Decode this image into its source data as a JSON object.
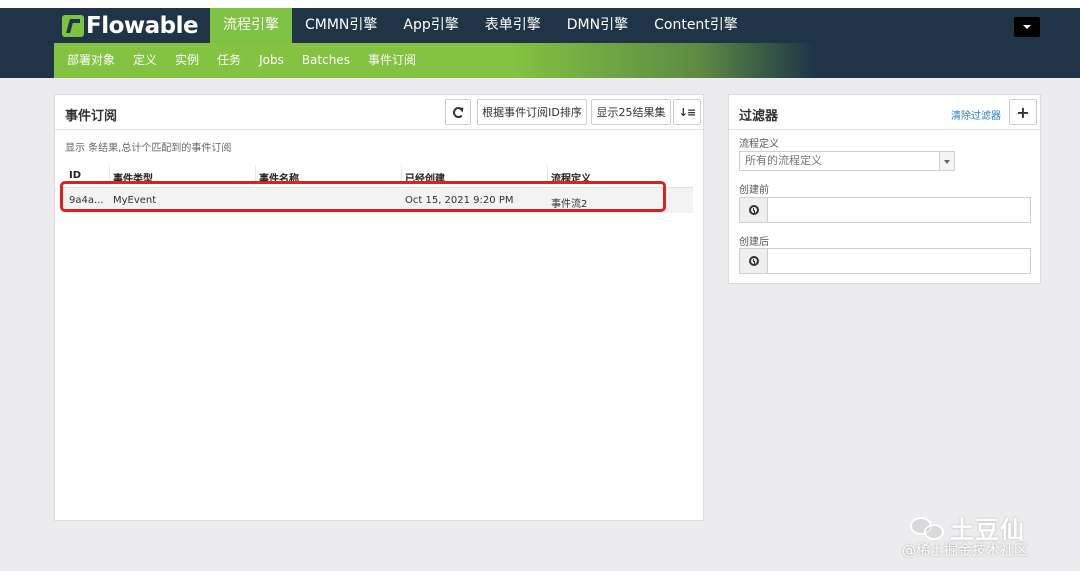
{
  "app": {
    "logo_text": "Flowable"
  },
  "main_nav": [
    {
      "label": "流程引擎",
      "active": true
    },
    {
      "label": "CMMN引擎"
    },
    {
      "label": "App引擎"
    },
    {
      "label": "表单引擎"
    },
    {
      "label": "DMN引擎"
    },
    {
      "label": "Content引擎"
    }
  ],
  "sub_nav": [
    {
      "label": "部署对象"
    },
    {
      "label": "定义"
    },
    {
      "label": "实例"
    },
    {
      "label": "任务"
    },
    {
      "label": "Jobs"
    },
    {
      "label": "Batches"
    },
    {
      "label": "事件订阅",
      "active": true
    }
  ],
  "list_panel": {
    "title": "事件订阅",
    "sort_button": "根据事件订阅ID排序",
    "show_button": "显示25结果集",
    "summary": "显示 条结果,总计个匹配到的事件订阅",
    "columns": [
      "ID",
      "事件类型",
      "事件名称",
      "已经创建",
      "流程定义"
    ],
    "rows": [
      {
        "id": "9a4a...",
        "event_type": "MyEvent",
        "event_name": "",
        "created": "Oct 15, 2021 9:20 PM",
        "process_definition": "事件流2"
      }
    ]
  },
  "filter_panel": {
    "title": "过滤器",
    "clear_link": "清除过滤器",
    "process_def_label": "流程定义",
    "process_def_value": "所有的流程定义",
    "created_before_label": "创建前",
    "created_after_label": "创建后"
  },
  "watermark": {
    "name": "土豆仙",
    "credit": "@稀土掘金技术社区"
  },
  "colors": {
    "navbar": "#1f3547",
    "accent_green": "#7dc242",
    "highlight_red": "#e02020",
    "link_blue": "#2a7fc2"
  }
}
